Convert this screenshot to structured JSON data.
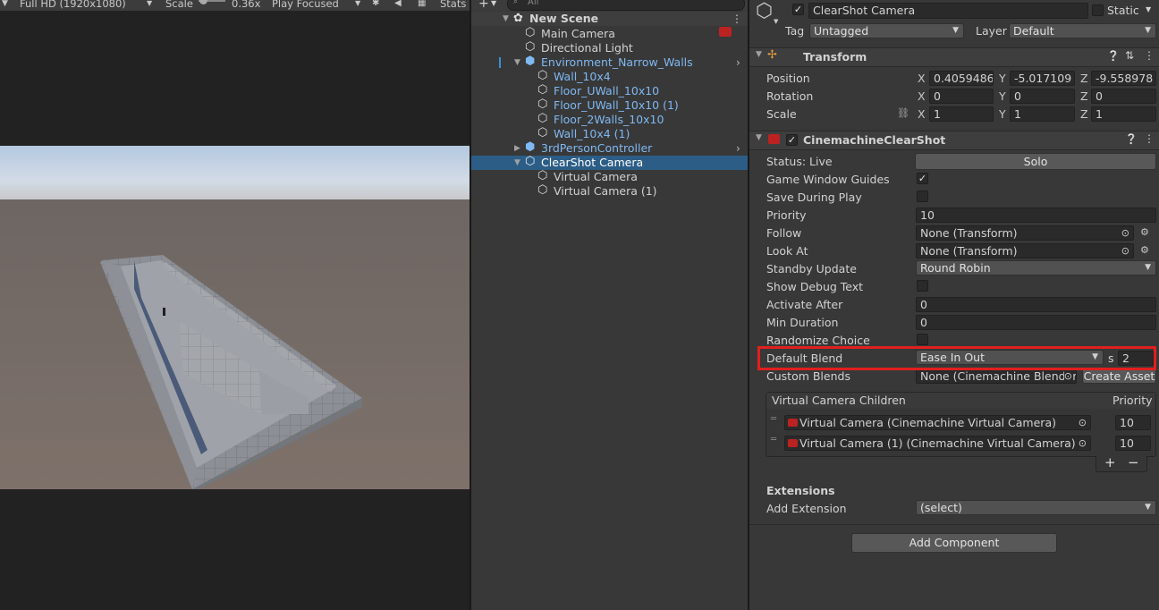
{
  "game_view": {
    "resolution": "Full HD (1920x1080)",
    "scale_label": "Scale",
    "scale_value": "0.36x",
    "play_mode": "Play Focused",
    "stats_label": "Stats"
  },
  "hierarchy": {
    "search_placeholder": "All",
    "scene_name": "New Scene",
    "items": [
      {
        "label": "Main Camera"
      },
      {
        "label": "Directional Light"
      },
      {
        "label": "Environment_Narrow_Walls"
      },
      {
        "label": "Wall_10x4"
      },
      {
        "label": "Floor_UWall_10x10"
      },
      {
        "label": "Floor_UWall_10x10 (1)"
      },
      {
        "label": "Floor_2Walls_10x10"
      },
      {
        "label": "Wall_10x4 (1)"
      },
      {
        "label": "3rdPersonController"
      },
      {
        "label": "ClearShot Camera"
      },
      {
        "label": "Virtual Camera"
      },
      {
        "label": "Virtual Camera (1)"
      }
    ]
  },
  "inspector": {
    "object_name": "ClearShot Camera",
    "static_label": "Static",
    "tag_label": "Tag",
    "tag_value": "Untagged",
    "layer_label": "Layer",
    "layer_value": "Default",
    "transform": {
      "title": "Transform",
      "position_label": "Position",
      "rotation_label": "Rotation",
      "scale_label": "Scale",
      "x": "X",
      "y": "Y",
      "z": "Z",
      "position": [
        "0.4059486",
        "-5.017109",
        "-9.558978"
      ],
      "rotation": [
        "0",
        "0",
        "0"
      ],
      "scale": [
        "1",
        "1",
        "1"
      ]
    },
    "clearshot": {
      "title": "CinemachineClearShot",
      "status_label": "Status: Live",
      "solo_label": "Solo",
      "game_window_guides_label": "Game Window Guides",
      "save_during_play_label": "Save During Play",
      "priority_label": "Priority",
      "priority_value": "10",
      "follow_label": "Follow",
      "follow_value": "None (Transform)",
      "look_at_label": "Look At",
      "look_at_value": "None (Transform)",
      "standby_update_label": "Standby Update",
      "standby_update_value": "Round Robin",
      "show_debug_text_label": "Show Debug Text",
      "activate_after_label": "Activate After",
      "activate_after_value": "0",
      "min_duration_label": "Min Duration",
      "min_duration_value": "0",
      "randomize_choice_label": "Randomize Choice",
      "default_blend_label": "Default Blend",
      "default_blend_value": "Ease In Out",
      "blend_seconds_label": "s",
      "blend_seconds_value": "2",
      "custom_blends_label": "Custom Blends",
      "custom_blends_value": "None (Cinemachine Blender",
      "create_asset_label": "Create Asset",
      "children_header": "Virtual Camera Children",
      "children_priority_header": "Priority",
      "children": [
        {
          "name": "Virtual Camera (Cinemachine Virtual Camera)",
          "priority": "10"
        },
        {
          "name": "Virtual Camera (1) (Cinemachine Virtual Camera)",
          "priority": "10"
        }
      ],
      "plus": "+",
      "minus": "−",
      "extensions_label": "Extensions",
      "add_extension_label": "Add Extension",
      "add_extension_value": "(select)"
    },
    "add_component_label": "Add Component"
  },
  "colors": {
    "highlight": "#e0201f",
    "selection": "#2c5d87",
    "prefab_blue": "#7fb8f2"
  }
}
